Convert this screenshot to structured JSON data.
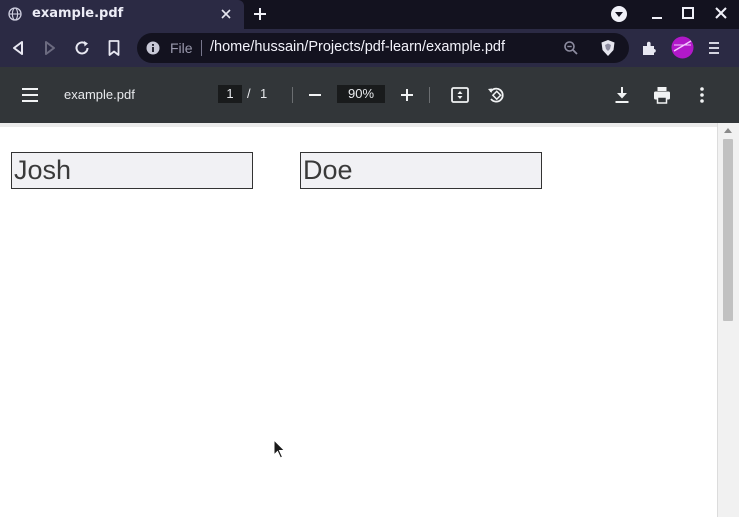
{
  "browser": {
    "tab": {
      "title": "example.pdf"
    },
    "address_bar": {
      "scheme_label": "File",
      "url": "/home/hussain/Projects/pdf-learn/example.pdf"
    },
    "accent_color": "#2b2a44"
  },
  "pdf_viewer": {
    "document_title": "example.pdf",
    "current_page": "1",
    "page_separator": "/",
    "total_pages": "1",
    "zoom": "90%"
  },
  "document": {
    "form_fields": [
      {
        "value": "Josh"
      },
      {
        "value": "Doe"
      }
    ]
  },
  "icons": [
    "globe-icon",
    "close-icon",
    "plus-icon",
    "chevron-down-icon",
    "minimize-icon",
    "maximize-icon",
    "window-close-icon",
    "back-icon",
    "forward-icon",
    "reload-icon",
    "bookmark-icon",
    "info-icon",
    "zoom-icon",
    "brave-shield-icon",
    "extensions-icon",
    "profile-icon",
    "menu-icon",
    "hamburger-icon",
    "zoom-out-icon",
    "zoom-in-icon",
    "fit-page-icon",
    "rotate-icon",
    "download-icon",
    "print-icon",
    "more-icon"
  ]
}
